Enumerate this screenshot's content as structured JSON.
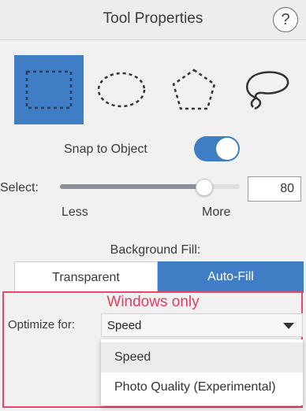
{
  "header": {
    "title": "Tool Properties",
    "help": "?"
  },
  "tools": [
    {
      "icon": "rectangle-selection-icon",
      "selected": true
    },
    {
      "icon": "ellipse-selection-icon",
      "selected": false
    },
    {
      "icon": "polygon-selection-icon",
      "selected": false
    },
    {
      "icon": "lasso-selection-icon",
      "selected": false
    }
  ],
  "snap": {
    "label": "Snap to Object",
    "on": true
  },
  "select": {
    "label": "Select:",
    "value": "80",
    "min_label": "Less",
    "max_label": "More",
    "fraction": 0.8
  },
  "background_fill": {
    "label": "Background Fill:",
    "options": [
      "Transparent",
      "Auto-Fill"
    ],
    "selected": "Auto-Fill"
  },
  "annotation": {
    "text": "Windows only",
    "color": "#e63b60"
  },
  "optimize": {
    "label": "Optimize for:",
    "value": "Speed",
    "options": [
      "Speed",
      "Photo Quality (Experimental)"
    ]
  },
  "colors": {
    "accent": "#3f7dc4"
  }
}
